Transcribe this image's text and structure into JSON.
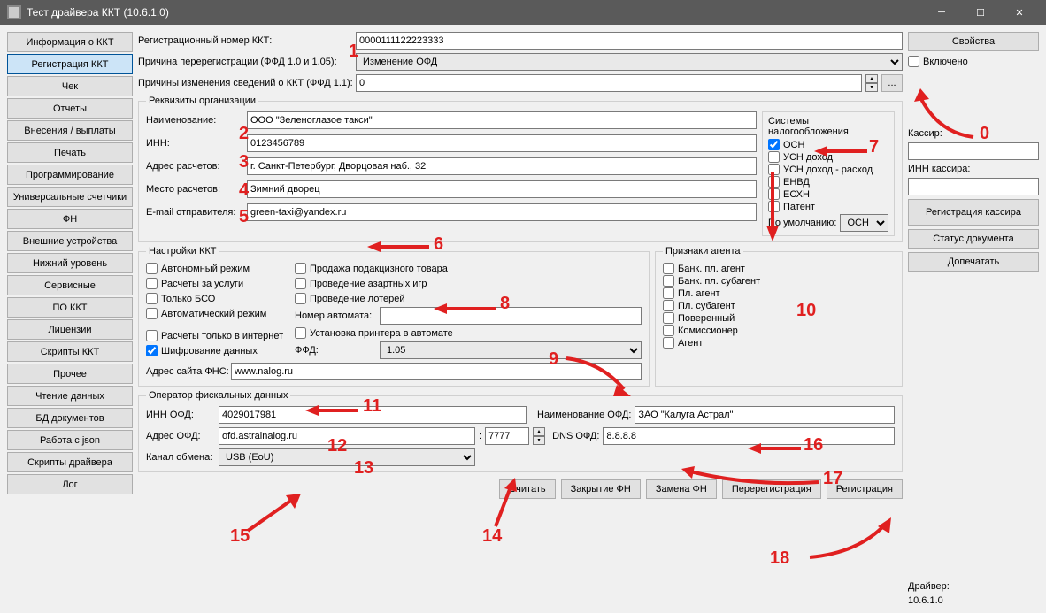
{
  "window": {
    "title": "Тест драйвера ККТ (10.6.1.0)"
  },
  "sidebar": {
    "items": [
      "Информация о ККТ",
      "Регистрация ККТ",
      "Чек",
      "Отчеты",
      "Внесения / выплаты",
      "Печать",
      "Программирование",
      "Универсальные счетчики",
      "ФН",
      "Внешние устройства",
      "Нижний уровень",
      "Сервисные",
      "ПО ККТ",
      "Лицензии",
      "Скрипты ККТ",
      "Прочее",
      "Чтение данных",
      "БД документов",
      "Работа с json",
      "Скрипты драйвера",
      "Лог"
    ],
    "active_index": 1
  },
  "fields": {
    "reg_number_label": "Регистрационный номер ККТ:",
    "reg_number_value": "0000111122223333",
    "rereg_reason_label": "Причина перерегистрации (ФФД 1.0 и 1.05):",
    "rereg_reason_value": "Изменение ОФД",
    "change_reasons_label": "Причины изменения сведений о ККТ (ФФД 1.1):",
    "change_reasons_value": "0"
  },
  "org": {
    "legend": "Реквизиты организации",
    "name_label": "Наименование:",
    "name_value": "ООО \"Зеленоглазое такси\"",
    "inn_label": "ИНН:",
    "inn_value": "0123456789",
    "calc_addr_label": "Адрес расчетов:",
    "calc_addr_value": "г. Санкт-Петербург, Дворцовая наб., 32",
    "calc_place_label": "Место расчетов:",
    "calc_place_value": "Зимний дворец",
    "email_label": "E-mail отправителя:",
    "email_value": "green-taxi@yandex.ru"
  },
  "tax": {
    "legend": "Системы налогообложения",
    "osn": "ОСН",
    "usn_income": "УСН доход",
    "usn_income_expense": "УСН доход - расход",
    "envd": "ЕНВД",
    "eshn": "ЕСХН",
    "patent": "Патент",
    "default_label": "По умолчанию:",
    "default_value": "ОСН"
  },
  "kkt_settings": {
    "legend": "Настройки ККТ",
    "autonomous": "Автономный режим",
    "services": "Расчеты за услуги",
    "bso_only": "Только БСО",
    "auto_mode": "Автоматический режим",
    "internet_only": "Расчеты только в интернет",
    "encryption": "Шифрование данных",
    "excise": "Продажа подакцизного товара",
    "gambling": "Проведение азартных игр",
    "lottery": "Проведение лотерей",
    "auto_number_label": "Номер автомата:",
    "auto_number_value": "",
    "printer_install": "Установка принтера в автомате",
    "ffd_label": "ФФД:",
    "ffd_value": "1.05",
    "fns_label": "Адрес сайта ФНС:",
    "fns_value": "www.nalog.ru"
  },
  "agent": {
    "legend": "Признаки агента",
    "bank_agent": "Банк. пл. агент",
    "bank_subagent": "Банк. пл. субагент",
    "pay_agent": "Пл. агент",
    "pay_subagent": "Пл. субагент",
    "attorney": "Поверенный",
    "commissioner": "Комиссионер",
    "agent_simple": "Агент"
  },
  "ofd": {
    "legend": "Оператор фискальных данных",
    "inn_label": "ИНН ОФД:",
    "inn_value": "4029017981",
    "name_label": "Наименование ОФД:",
    "name_value": "ЗАО \"Калуга Астрал\"",
    "addr_label": "Адрес ОФД:",
    "addr_value": "ofd.astralnalog.ru",
    "port_value": "7777",
    "dns_label": "DNS ОФД:",
    "dns_value": "8.8.8.8",
    "channel_label": "Канал обмена:",
    "channel_value": "USB (EoU)"
  },
  "buttons": {
    "read": "Считать",
    "close_fn": "Закрытие ФН",
    "replace_fn": "Замена ФН",
    "rereg": "Перерегистрация",
    "reg": "Регистрация"
  },
  "right": {
    "properties": "Свойства",
    "enabled": "Включено",
    "cashier_label": "Кассир:",
    "cashier_value": "",
    "cashier_inn_label": "ИНН кассира:",
    "cashier_inn_value": "",
    "reg_cashier": "Регистрация кассира",
    "doc_status": "Статус документа",
    "print_more": "Допечатать",
    "driver_label": "Драйвер:",
    "driver_version": "10.6.1.0"
  },
  "annotations": {
    "0": "0",
    "1": "1",
    "2": "2",
    "3": "3",
    "4": "4",
    "5": "5",
    "6": "6",
    "7": "7",
    "8": "8",
    "9": "9",
    "10": "10",
    "11": "11",
    "12": "12",
    "13": "13",
    "14": "14",
    "15": "15",
    "16": "16",
    "17": "17",
    "18": "18"
  }
}
